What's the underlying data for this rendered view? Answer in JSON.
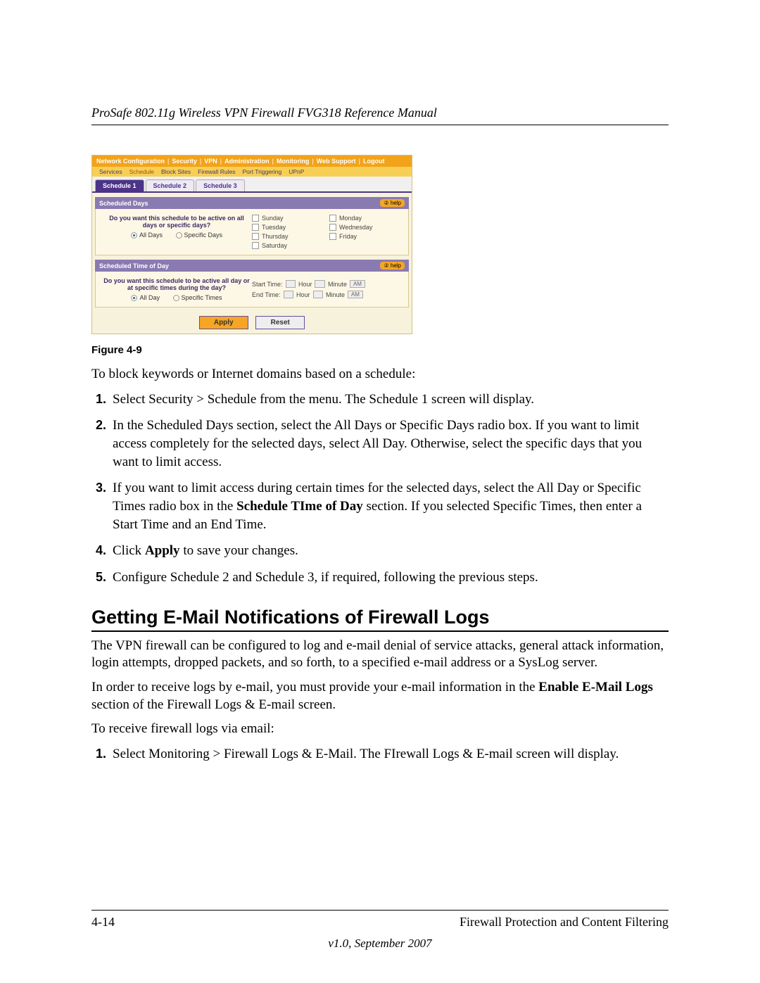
{
  "header": {
    "running_title": "ProSafe 802.11g Wireless VPN Firewall FVG318 Reference Manual"
  },
  "ui": {
    "topbar": {
      "items": [
        "Network Configuration",
        "Security",
        "VPN",
        "Administration",
        "Monitoring",
        "Web Support",
        "Logout"
      ]
    },
    "subbar": {
      "items": [
        "Services",
        "Schedule",
        "Block Sites",
        "Firewall Rules",
        "Port Triggering",
        "UPnP"
      ]
    },
    "tabs": {
      "items": [
        "Schedule 1",
        "Schedule 2",
        "Schedule 3"
      ],
      "active": 0
    },
    "section_days": {
      "title": "Scheduled Days",
      "help_label": "help",
      "question": "Do you want this schedule to be active on all days or specific days?",
      "opt_all": "All Days",
      "opt_specific": "Specific Days",
      "days": [
        "Sunday",
        "Monday",
        "Tuesday",
        "Wednesday",
        "Thursday",
        "Friday",
        "Saturday"
      ]
    },
    "section_time": {
      "title": "Scheduled Time of Day",
      "help_label": "help",
      "question": "Do you want this schedule to be active all day or at specific times during the day?",
      "opt_all": "All Day",
      "opt_specific": "Specific Times",
      "start_label": "Start Time:",
      "end_label": "End Time:",
      "hour_label": "Hour",
      "minute_label": "Minute",
      "ampm_label": "AM"
    },
    "buttons": {
      "apply": "Apply",
      "reset": "Reset"
    }
  },
  "fig_caption": "Figure 4-9",
  "intro_para": "To block keywords or Internet domains based on a schedule:",
  "steps": [
    "Select Security > Schedule from the menu. The Schedule 1 screen will display.",
    "In the Scheduled Days section, select the All Days or Specific Days radio box. If you want to limit access completely for the selected days, select All Day. Otherwise, select the specific days that you want to limit access.",
    "If you want to limit access during certain times for the selected days, select the All Day or Specific Times radio box in the ",
    "Click ",
    "Configure Schedule 2 and Schedule 3, if required, following the previous steps."
  ],
  "step3_bold": "Schedule TIme of Day",
  "step3_tail": " section. If you selected Specific Times, then enter a Start Time and an End Time.",
  "step4_bold": "Apply",
  "step4_tail": " to save your changes.",
  "h2": "Getting E-Mail Notifications of Firewall Logs",
  "p1": "The VPN firewall can be configured to log and e-mail denial of service attacks, general attack information, login attempts, dropped packets, and so forth, to a specified e-mail address or a SysLog server.",
  "p2_lead": "In order to receive logs by e-mail, you must provide your e-mail information in the ",
  "p2_bold": "Enable E-Mail Logs",
  "p2_tail": " section of the Firewall Logs & E-mail screen.",
  "p3": "To receive firewall logs via email:",
  "step_b1": "Select Monitoring > Firewall Logs & E-Mail. The FIrewall Logs & E-mail screen will display.",
  "footer": {
    "page": "4-14",
    "chapter": "Firewall Protection and Content Filtering",
    "version": "v1.0, September 2007"
  }
}
